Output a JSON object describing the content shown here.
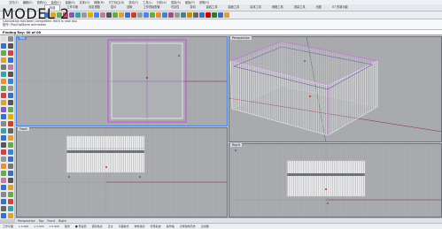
{
  "overlay_title": "MODEL 2",
  "menu": [
    "文件(F)",
    "编辑(E)",
    "查看(V)",
    "曲线(C)",
    "曲面(S)",
    "实体(O)",
    "网格(M)",
    "尺寸标注(D)",
    "变动(T)",
    "工具(L)",
    "分析(A)",
    "渲染(R)",
    "面板(P)",
    "说明(H)"
  ],
  "tabs": [
    "标准",
    "工作平面",
    "设定视图",
    "显示",
    "选取",
    "工作视窗配置",
    "可见性",
    "变动",
    "曲线工具",
    "曲面工具",
    "实体工具",
    "网格工具",
    "渲染工具",
    "出图",
    "V7 的新功能"
  ],
  "active_tab_index": 0,
  "command_history": [
    "Calculation has been completed. Here is new dxy.",
    "指令: PlayOgStorm animation"
  ],
  "command_prompt": "Finding Ray: 00 of 00",
  "viewports": {
    "top": {
      "label": "Top"
    },
    "perspective": {
      "label": "Perspective"
    },
    "front": {
      "label": "Front"
    },
    "right": {
      "label": "Right"
    }
  },
  "viewport_tabs": [
    "Perspective",
    "Top",
    "Front",
    "Right"
  ],
  "status": [
    "工作平面",
    "x 0.000",
    "y 0.000",
    "z 0.000",
    "毫米",
    "■ 预设值",
    "锁定格点",
    "正交",
    "平面模式",
    "物件锁点",
    "智慧轨迹",
    "操作轴",
    "记录建构历史",
    "过滤器"
  ],
  "colors": {
    "viewport_bg": "#a7a9ac",
    "grid_line": "#b8babd",
    "x_axis": "#8a2a2a",
    "y_axis": "#2e6a2e",
    "selection": "#c05ad8",
    "active_label": "#5b8bd9"
  }
}
